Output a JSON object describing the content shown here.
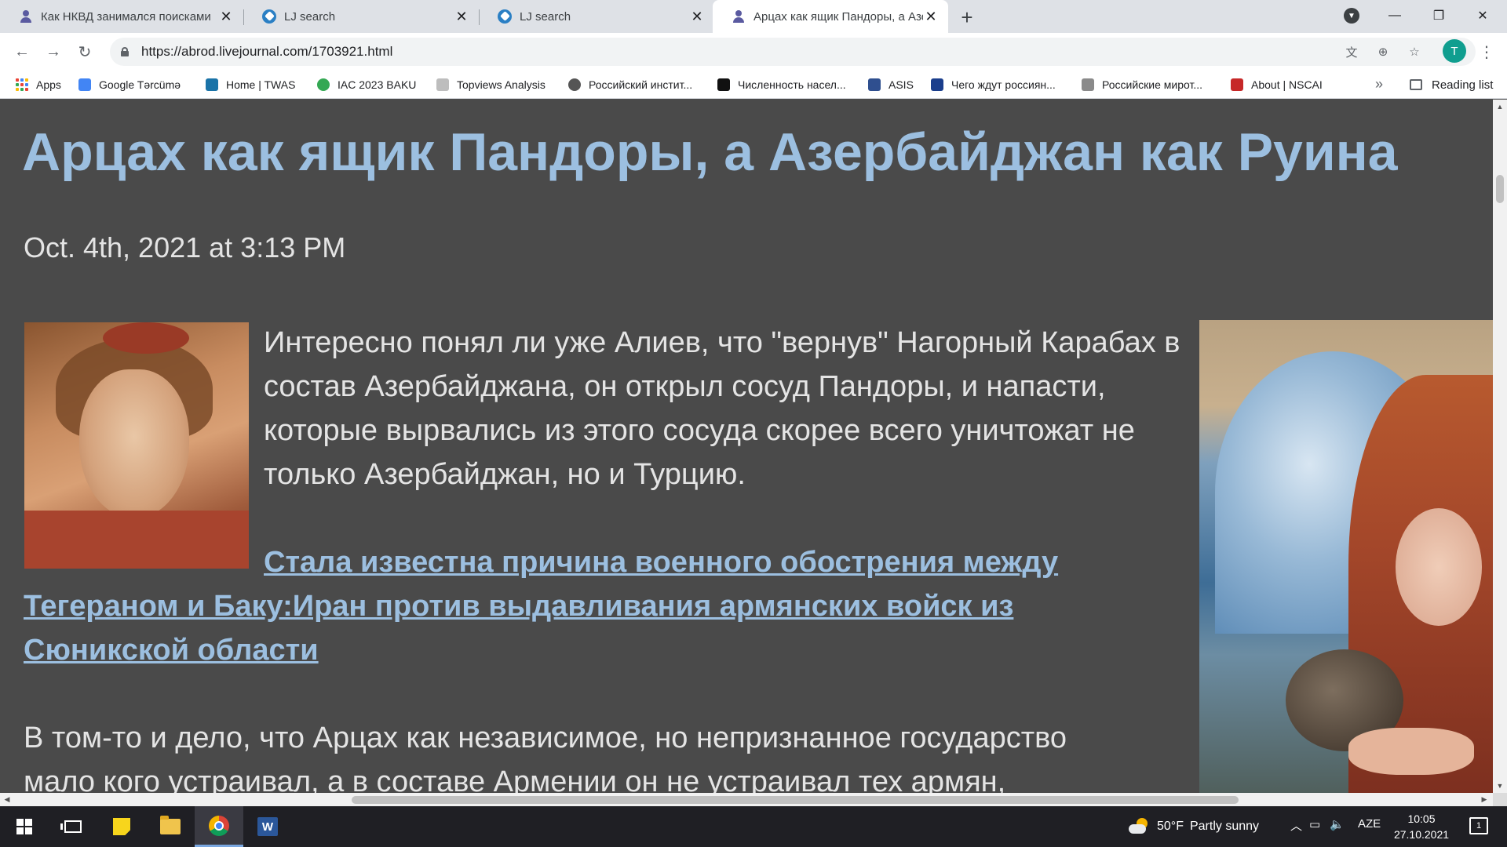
{
  "browser": {
    "tabs": [
      {
        "title": "Как НКВД занимался поисками",
        "icon": "person-icon"
      },
      {
        "title": "LJ search",
        "icon": "livejournal-icon"
      },
      {
        "title": "LJ search",
        "icon": "livejournal-icon"
      },
      {
        "title": "Арцах как ящик Пандоры, а Азе",
        "icon": "person-icon",
        "active": true
      }
    ],
    "new_tab": "+",
    "url": "https://abrod.livejournal.com/1703921.html",
    "profile_initial": "T",
    "window_controls": {
      "minimize": "—",
      "maximize": "❐",
      "close": "✕"
    }
  },
  "bookmarks": {
    "items": [
      {
        "label": "Apps",
        "color": "#ea4335"
      },
      {
        "label": "Google Tərcümə",
        "color": "#4285f4"
      },
      {
        "label": "Home | TWAS",
        "color": "#1a73a8"
      },
      {
        "label": "IAC 2023 BAKU",
        "color": "#34a853"
      },
      {
        "label": "Topviews Analysis",
        "color": "#bdbdbd"
      },
      {
        "label": "Российский инстит...",
        "color": "#555555"
      },
      {
        "label": "Численность насел...",
        "color": "#111111"
      },
      {
        "label": "ASIS",
        "color": "#2f4f8f"
      },
      {
        "label": "Чего ждут россиян...",
        "color": "#1a3e8c"
      },
      {
        "label": "Российские мирот...",
        "color": "#8a8a8a"
      },
      {
        "label": "About | NSCAI",
        "color": "#c62828"
      }
    ],
    "more": "»",
    "reading_list": "Reading list"
  },
  "post": {
    "title": "Арцах как ящик Пандоры, а Азербайджан как Руина",
    "date": "Oct. 4th, 2021 at 3:13 PM",
    "paragraph1": "Интересно понял ли уже Алиев, что \"вернув\" Нагорный Карабах в состав Азербайджана, он открыл сосуд Пандоры, и напасти, которые вырвались из этого сосуда скорее всего уничтожат не только Азербайджан, но и Турцию.",
    "link_lines": [
      "Стала известна причина военного обострения между",
      "Тегераном и Баку:Иран против выдавливания армянских войск из",
      "Сюникской области"
    ],
    "paragraph2_lines": [
      "В том-то и дело, что Арцах как независимое, но непризнанное государство",
      "мало кого устраивал, а в составе Армении он не устраивал тех армян,"
    ],
    "colors": {
      "background": "#4a4a4a",
      "title": "#9cbfe0",
      "text": "#e4e4e4"
    }
  },
  "taskbar": {
    "weather": {
      "temp": "50°F",
      "condition": "Partly sunny"
    },
    "language": "AZE",
    "time": "10:05",
    "date": "27.10.2021",
    "notifications": "1"
  }
}
